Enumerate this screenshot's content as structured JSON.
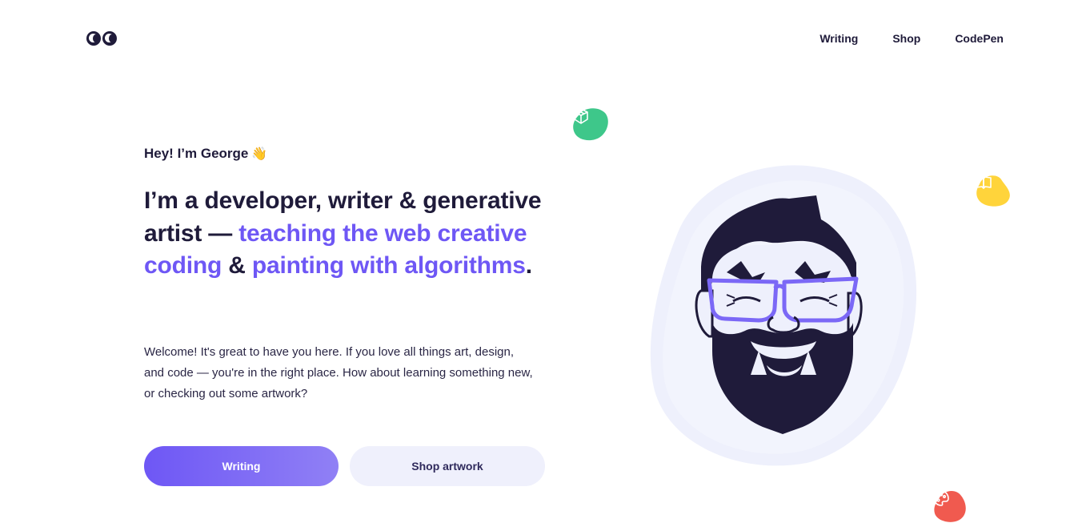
{
  "nav": {
    "logo_icon": "eyes-logo-icon",
    "items": [
      {
        "label": "Writing"
      },
      {
        "label": "Shop"
      },
      {
        "label": "CodePen"
      }
    ]
  },
  "hero": {
    "greeting": "Hey! I’m George",
    "wave_emoji": "👋",
    "headline": {
      "part1": "I’m a developer, writer & generative artist — ",
      "part2": "teaching the web creative coding",
      "part3": " & ",
      "part4": "painting with algorithms",
      "part5": "."
    },
    "welcome": "Welcome! It's great to have you here. If you love all things art, design, and code — you're in the right place. How about learning something new, or checking out some artwork?",
    "buttons": {
      "primary": "Writing",
      "secondary": "Shop artwork"
    }
  },
  "decorations": {
    "green_blob_icon": "cube-icon",
    "yellow_blob_icon": "book-icon",
    "red_blob_icon": "palette-icon",
    "portrait": "george-portrait-illustration"
  },
  "colors": {
    "accent": "#6e57f5",
    "text": "#1f1b3a",
    "green": "#3ec78a",
    "yellow": "#ffd43b",
    "red": "#f05a4f",
    "portrait_bg": "#eef0fc"
  }
}
